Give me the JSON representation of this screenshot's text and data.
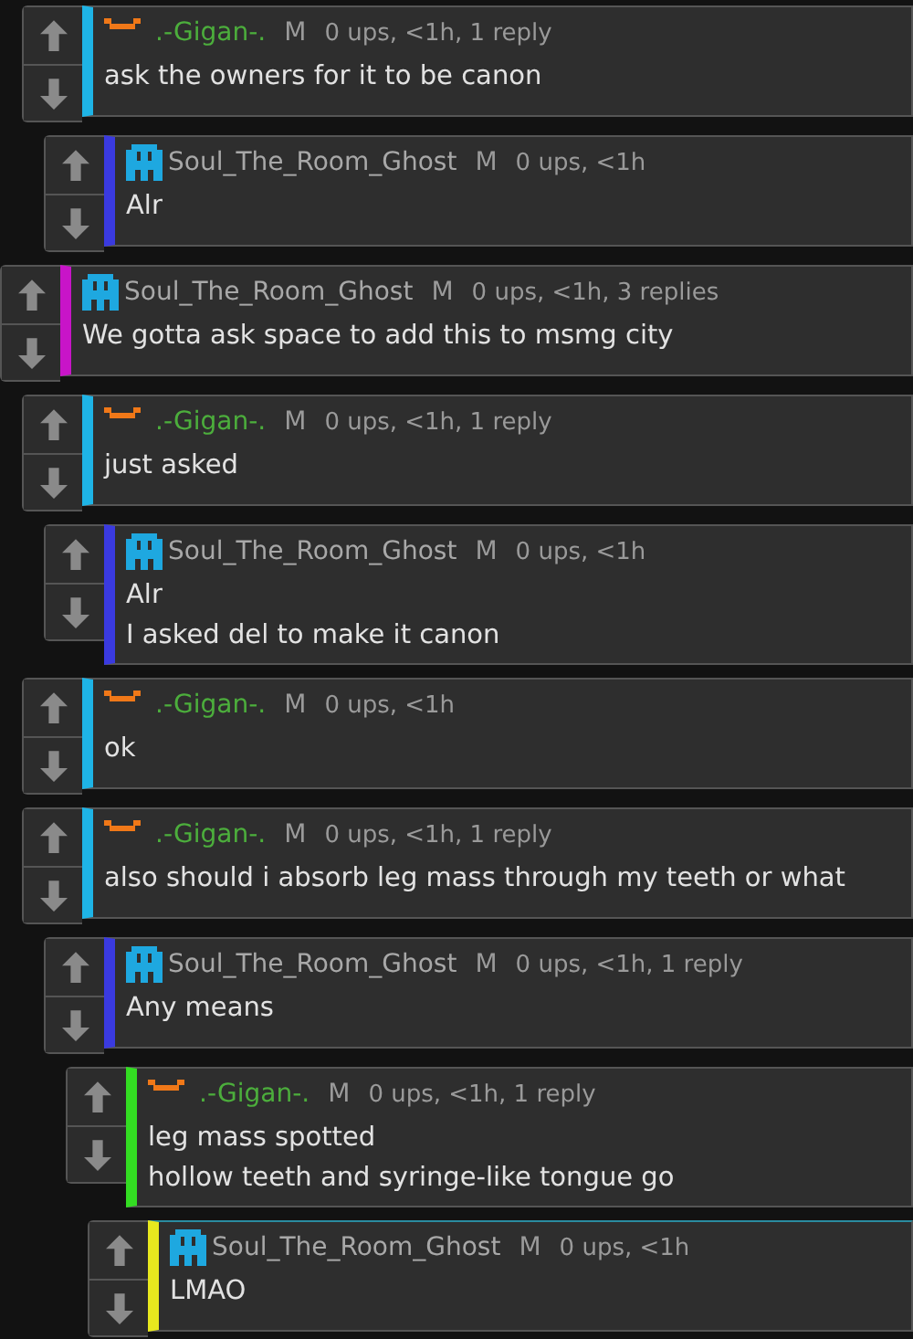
{
  "comments": [
    {
      "kind": "reply",
      "author": {
        "name": ".-Gigan-.",
        "kind": "bracket",
        "color": "#4cae3c"
      },
      "mod": "M",
      "meta": "0 ups, <1h, 1 reply",
      "text": [
        "ask the owners for it to be canon"
      ],
      "color": "#1eb4e6",
      "highlighted": false,
      "children": [
        {
          "author": {
            "name": "Soul_The_Room_Ghost",
            "kind": "ghost",
            "color": "#a8a8a8"
          },
          "mod": "M",
          "meta": "0 ups, <1h",
          "text": [
            "Alr"
          ],
          "color": "#3a3ae0",
          "highlighted": false
        }
      ]
    },
    {
      "kind": "top",
      "author": {
        "name": "Soul_The_Room_Ghost",
        "kind": "ghost",
        "color": "#a8a8a8"
      },
      "mod": "M",
      "meta": "0 ups, <1h, 3 replies",
      "text": [
        "We gotta ask space to add this to msmg city"
      ],
      "color": "#c814c8",
      "highlighted": false,
      "children": [
        {
          "author": {
            "name": ".-Gigan-.",
            "kind": "bracket",
            "color": "#4cae3c"
          },
          "mod": "M",
          "meta": "0 ups, <1h, 1 reply",
          "text": [
            "just asked"
          ],
          "color": "#1eb4e6",
          "highlighted": false,
          "children": [
            {
              "author": {
                "name": "Soul_The_Room_Ghost",
                "kind": "ghost",
                "color": "#a8a8a8"
              },
              "mod": "M",
              "meta": "0 ups, <1h",
              "text": [
                "Alr",
                "I asked del to make it canon"
              ],
              "color": "#3a3ae0",
              "highlighted": false
            }
          ]
        },
        {
          "author": {
            "name": ".-Gigan-.",
            "kind": "bracket",
            "color": "#4cae3c"
          },
          "mod": "M",
          "meta": "0 ups, <1h",
          "text": [
            "ok"
          ],
          "color": "#1eb4e6",
          "highlighted": false
        },
        {
          "author": {
            "name": ".-Gigan-.",
            "kind": "bracket",
            "color": "#4cae3c"
          },
          "mod": "M",
          "meta": "0 ups, <1h, 1 reply",
          "text": [
            "also should i absorb leg mass through my teeth or what"
          ],
          "color": "#1eb4e6",
          "highlighted": false,
          "children": [
            {
              "author": {
                "name": "Soul_The_Room_Ghost",
                "kind": "ghost",
                "color": "#a8a8a8"
              },
              "mod": "M",
              "meta": "0 ups, <1h, 1 reply",
              "text": [
                "Any means"
              ],
              "color": "#3a3ae0",
              "highlighted": false,
              "children": [
                {
                  "author": {
                    "name": ".-Gigan-.",
                    "kind": "bracket",
                    "color": "#4cae3c"
                  },
                  "mod": "M",
                  "meta": "0 ups, <1h, 1 reply",
                  "text": [
                    "leg mass spotted",
                    "hollow teeth and syringe-like tongue go"
                  ],
                  "color": "#33dd22",
                  "highlighted": false,
                  "children": [
                    {
                      "author": {
                        "name": "Soul_The_Room_Ghost",
                        "kind": "ghost",
                        "color": "#a8a8a8"
                      },
                      "mod": "M",
                      "meta": "0 ups, <1h",
                      "text": [
                        "LMAO"
                      ],
                      "color": "#e8e81e",
                      "highlighted": true
                    }
                  ]
                }
              ]
            }
          ]
        }
      ]
    }
  ]
}
